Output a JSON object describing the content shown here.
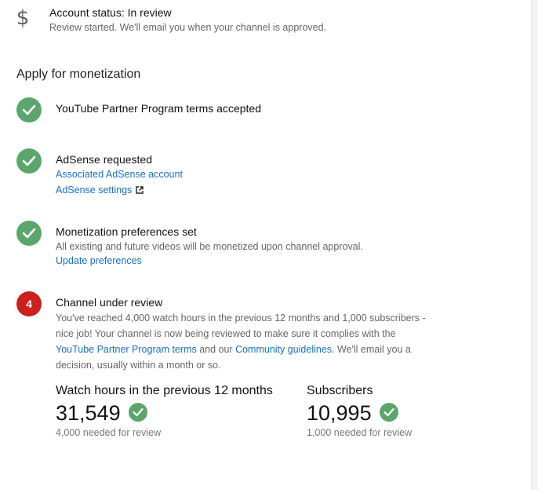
{
  "account_status": {
    "icon": "dollar-icon",
    "title": "Account status: In review",
    "subtitle": "Review started. We'll email you when your channel is approved."
  },
  "section": {
    "heading": "Apply for monetization"
  },
  "steps": [
    {
      "status": "complete",
      "title": "YouTube Partner Program terms accepted"
    },
    {
      "status": "complete",
      "title": "AdSense requested",
      "links": [
        "Associated AdSense account",
        "AdSense settings"
      ]
    },
    {
      "status": "complete",
      "title": "Monetization preferences set",
      "text": "All existing and future videos will be monetized upon channel approval.",
      "links": [
        "Update preferences"
      ]
    },
    {
      "status": "in-progress",
      "number": "4",
      "title": "Channel under review",
      "text_part1": "You've reached 4,000 watch hours in the previous 12 months and 1,000 subscribers - nice job! Your channel is now being reviewed to make sure it complies with the ",
      "link1": "YouTube Partner Program terms",
      "text_part2": " and our ",
      "link2": "Community guidelines",
      "text_part3": ". We'll email you a decision, usually within a month or so."
    }
  ],
  "metrics": {
    "watch_hours": {
      "label": "Watch hours in the previous 12 months",
      "value": "31,549",
      "note": "4,000 needed for review",
      "met": true
    },
    "subscribers": {
      "label": "Subscribers",
      "value": "10,995",
      "note": "1,000 needed for review",
      "met": true
    }
  },
  "colors": {
    "check_green": "#5ba66a",
    "step_red": "#cc1f1f",
    "link_blue": "#1a6fc7"
  }
}
